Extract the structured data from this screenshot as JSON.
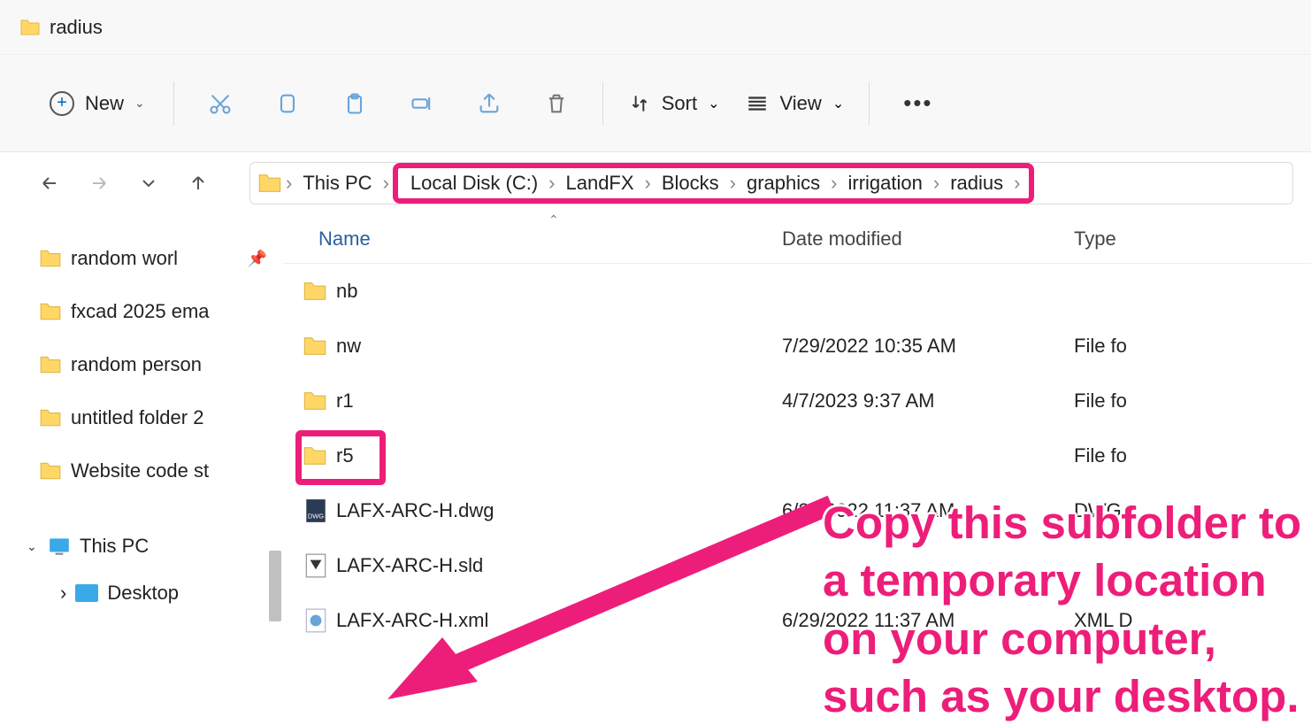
{
  "window": {
    "title": "radius"
  },
  "toolbar": {
    "new_label": "New",
    "sort_label": "Sort",
    "view_label": "View"
  },
  "breadcrumb": {
    "items": [
      "This PC",
      "Local Disk (C:)",
      "LandFX",
      "Blocks",
      "graphics",
      "irrigation",
      "radius"
    ]
  },
  "sidebar": {
    "items": [
      {
        "label": "random worl",
        "pinned": true
      },
      {
        "label": "fxcad 2025 ema"
      },
      {
        "label": "random person"
      },
      {
        "label": "untitled folder 2"
      },
      {
        "label": "Website code st"
      }
    ],
    "this_pc": "This PC",
    "desktop": "Desktop"
  },
  "columns": {
    "name": "Name",
    "date": "Date modified",
    "type": "Type"
  },
  "files": [
    {
      "name": "nb",
      "date": "",
      "type": "",
      "kind": "folder"
    },
    {
      "name": "nw",
      "date": "7/29/2022 10:35 AM",
      "type": "File fo",
      "kind": "folder"
    },
    {
      "name": "r1",
      "date": "4/7/2023 9:37 AM",
      "type": "File fo",
      "kind": "folder"
    },
    {
      "name": "r5",
      "date": "",
      "type": "File fo",
      "kind": "folder"
    },
    {
      "name": "LAFX-ARC-H.dwg",
      "date": "6/29/2022 11:37 AM",
      "type": "DWG",
      "kind": "dwg"
    },
    {
      "name": "LAFX-ARC-H.sld",
      "date": "",
      "type": "",
      "kind": "sld"
    },
    {
      "name": "LAFX-ARC-H.xml",
      "date": "6/29/2022 11:37 AM",
      "type": "XML D",
      "kind": "xml"
    }
  ],
  "annotation": {
    "line1": "Copy this subfolder to",
    "line2": "a temporary location",
    "line3": "on your computer,",
    "line4": "such as your desktop."
  }
}
